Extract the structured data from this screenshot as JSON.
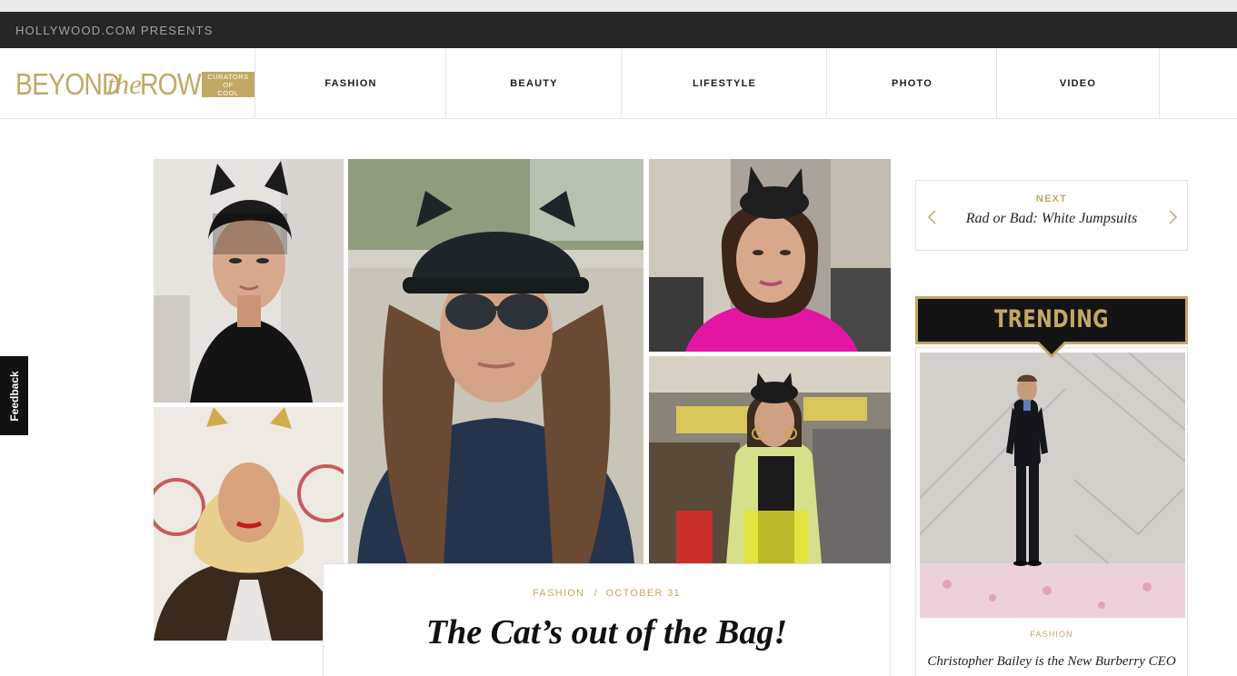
{
  "presents_bar": {
    "text": "HOLLYWOOD.COM PRESENTS"
  },
  "logo": {
    "word_beyond": "BEYOND",
    "word_the": "the",
    "word_row": "ROW",
    "tagline_1": "CURATORS",
    "tagline_2": "OF",
    "tagline_3": "COOL"
  },
  "nav": {
    "items": [
      {
        "label": "FASHION"
      },
      {
        "label": "BEAUTY"
      },
      {
        "label": "LIFESTYLE"
      },
      {
        "label": "PHOTO"
      },
      {
        "label": "VIDEO"
      }
    ]
  },
  "article": {
    "category": "FASHION",
    "separator": "/",
    "date": "OCTOBER 31",
    "title": "The Cat’s out of the Bag!"
  },
  "feedback": {
    "label": "Feedback"
  },
  "next": {
    "label": "NEXT",
    "title": "Rad or Bad: White Jumpsuits",
    "prev_icon": "chevron-left-icon",
    "next_icon": "chevron-right-icon"
  },
  "trending": {
    "heading": "TRENDING",
    "category": "FASHION",
    "title": "Christopher Bailey is the New Burberry CEO"
  },
  "colors": {
    "gold": "#c2a865",
    "dark_bar": "#262626",
    "banner_bg": "#141414",
    "border": "#e1e1e1"
  }
}
